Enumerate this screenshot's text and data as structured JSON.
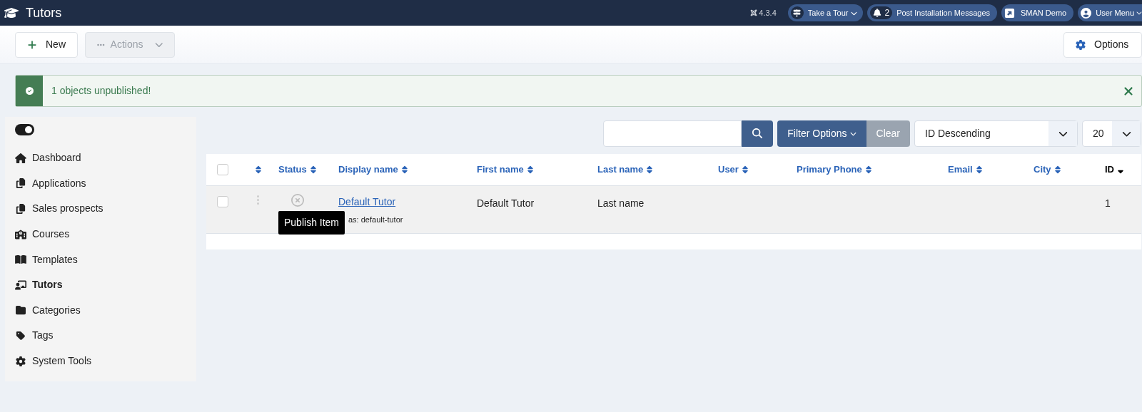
{
  "header": {
    "title": "Tutors",
    "version": "4.3.4",
    "tour": {
      "label": "Take a Tour"
    },
    "messages": {
      "count": "2",
      "label": "Post Installation Messages"
    },
    "site": {
      "label": "SMAN Demo"
    },
    "user": {
      "label": "User Menu"
    }
  },
  "toolbar": {
    "new": "New",
    "actions": {
      "label": "Actions",
      "disabled": true
    },
    "options": "Options"
  },
  "alert": {
    "message": "1 objects unpublished!"
  },
  "sidebar": {
    "toggle": {
      "on": true
    },
    "items": [
      {
        "label": "Dashboard",
        "kind": "home",
        "selected": false
      },
      {
        "label": "Applications",
        "kind": "copy",
        "selected": false
      },
      {
        "label": "Sales prospects",
        "kind": "copy",
        "selected": false
      },
      {
        "label": "Courses",
        "kind": "school",
        "selected": false
      },
      {
        "label": "Templates",
        "kind": "book",
        "selected": false
      },
      {
        "label": "Tutors",
        "kind": "teacher",
        "selected": true
      },
      {
        "label": "Categories",
        "kind": "folder",
        "selected": false
      },
      {
        "label": "Tags",
        "kind": "tag",
        "selected": false
      },
      {
        "label": "System Tools",
        "kind": "gear",
        "selected": false
      }
    ]
  },
  "filters": {
    "filter_options": "Filter Options",
    "clear": "Clear",
    "ordering": "ID Descending",
    "limit": "20"
  },
  "table": {
    "select_all": {
      "checked": false
    },
    "columns": [
      {
        "label": "Status",
        "sorted": false
      },
      {
        "label": "Display name",
        "sorted": false
      },
      {
        "label": "First name",
        "sorted": false
      },
      {
        "label": "Last name",
        "sorted": false
      },
      {
        "label": "User",
        "sorted": false
      },
      {
        "label": "Primary Phone",
        "sorted": false
      },
      {
        "label": "Email",
        "sorted": false
      },
      {
        "label": "City",
        "sorted": false
      },
      {
        "label": "ID",
        "sorted": true
      }
    ],
    "rows": [
      {
        "checked": false,
        "published": false,
        "display_name": "Default Tutor",
        "alias": "as: default-tutor",
        "first_name": "Default Tutor",
        "last_name": "Last name",
        "id": "1"
      }
    ]
  },
  "tooltip": "Publish Item"
}
